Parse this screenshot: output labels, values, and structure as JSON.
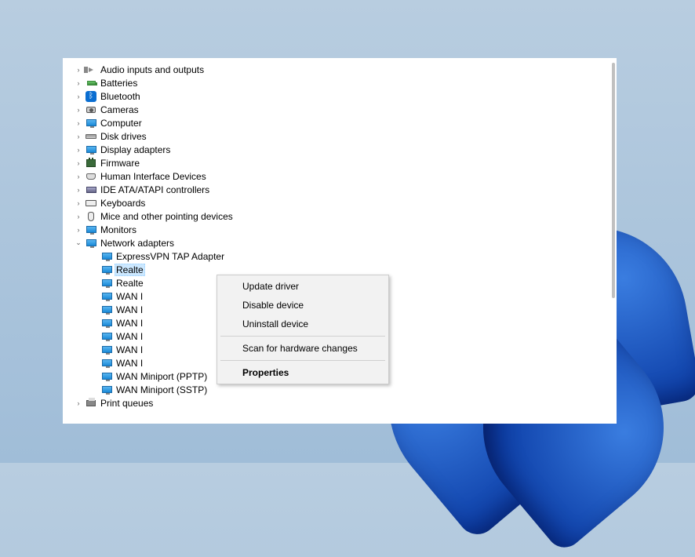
{
  "tree": {
    "categories": [
      {
        "name": "Audio inputs and outputs",
        "icon": "audio"
      },
      {
        "name": "Batteries",
        "icon": "battery"
      },
      {
        "name": "Bluetooth",
        "icon": "bluetooth"
      },
      {
        "name": "Cameras",
        "icon": "camera"
      },
      {
        "name": "Computer",
        "icon": "monitor"
      },
      {
        "name": "Disk drives",
        "icon": "disk"
      },
      {
        "name": "Display adapters",
        "icon": "monitor"
      },
      {
        "name": "Firmware",
        "icon": "chip"
      },
      {
        "name": "Human Interface Devices",
        "icon": "hid"
      },
      {
        "name": "IDE ATA/ATAPI controllers",
        "icon": "ide"
      },
      {
        "name": "Keyboards",
        "icon": "keyboard"
      },
      {
        "name": "Mice and other pointing devices",
        "icon": "mouse"
      },
      {
        "name": "Monitors",
        "icon": "monitor"
      }
    ],
    "expanded_category": "Network adapters",
    "network_children": [
      {
        "name": "ExpressVPN TAP Adapter",
        "selected": false
      },
      {
        "name": "Realte",
        "selected": true
      },
      {
        "name": "Realte",
        "selected": false
      },
      {
        "name": "WAN I",
        "selected": false
      },
      {
        "name": "WAN I",
        "selected": false
      },
      {
        "name": "WAN I",
        "selected": false
      },
      {
        "name": "WAN I",
        "selected": false
      },
      {
        "name": "WAN I",
        "selected": false
      },
      {
        "name": "WAN I",
        "selected": false
      },
      {
        "name": "WAN Miniport (PPTP)",
        "selected": false
      },
      {
        "name": "WAN Miniport (SSTP)",
        "selected": false
      }
    ],
    "last_category": "Print queues"
  },
  "context_menu": {
    "items": [
      {
        "label": "Update driver",
        "bold": false
      },
      {
        "label": "Disable device",
        "bold": false
      },
      {
        "label": "Uninstall device",
        "bold": false
      }
    ],
    "group2": [
      {
        "label": "Scan for hardware changes",
        "bold": false
      }
    ],
    "group3": [
      {
        "label": "Properties",
        "bold": true
      }
    ]
  }
}
